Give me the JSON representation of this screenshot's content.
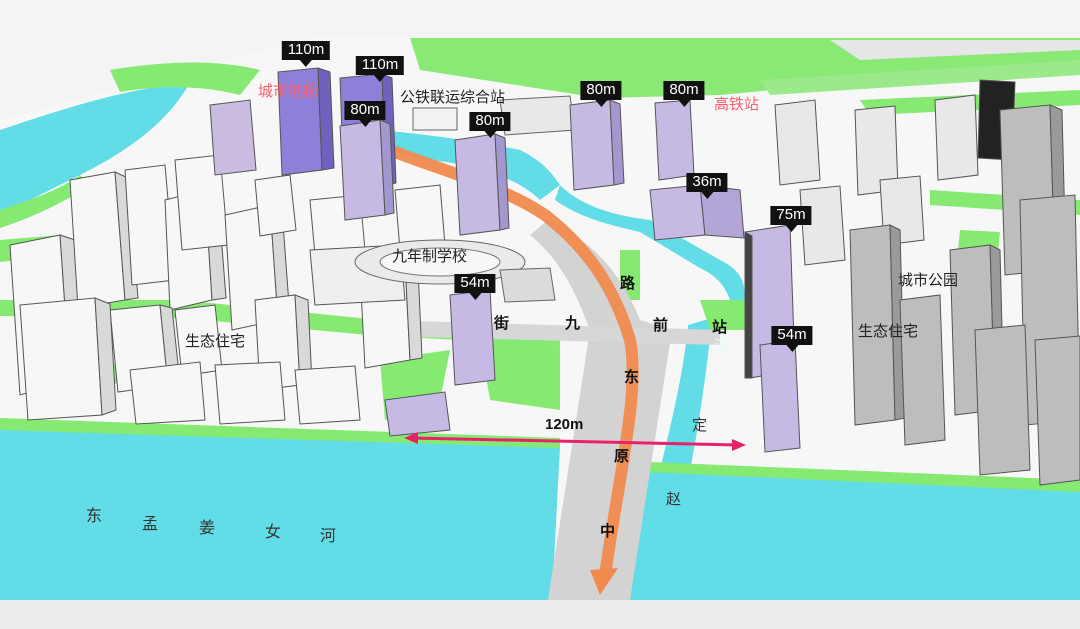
{
  "height_tags": [
    {
      "id": "landmark-1",
      "text": "110m"
    },
    {
      "id": "landmark-2",
      "text": "110m"
    },
    {
      "id": "tower-80-a",
      "text": "80m"
    },
    {
      "id": "tower-80-b",
      "text": "80m"
    },
    {
      "id": "tower-80-c",
      "text": "80m"
    },
    {
      "id": "tower-80-d",
      "text": "80m"
    },
    {
      "id": "tower-36",
      "text": "36m"
    },
    {
      "id": "tower-75",
      "text": "75m"
    },
    {
      "id": "tower-54-a",
      "text": "54m"
    },
    {
      "id": "tower-54-b",
      "text": "54m"
    }
  ],
  "place_labels": {
    "city_landmark": "城市地标",
    "rail_hub": "公铁联运综合站",
    "high_speed_station": "高铁站",
    "school": "九年制学校",
    "city_park": "城市公园",
    "eco_residential_left": "生态住宅",
    "eco_residential_right": "生态住宅"
  },
  "road_labels": {
    "zhongyuan_east_road": [
      "路",
      "东",
      "原",
      "中"
    ],
    "jiuqian_street": [
      "街",
      "九",
      "前",
      "站"
    ],
    "zhaoding_river": [
      "河",
      "定",
      "赵"
    ]
  },
  "river_label": [
    "东",
    "孟",
    "姜",
    "女",
    "河"
  ],
  "dimension": {
    "text": "120m"
  },
  "colors": {
    "water": "#62dce6",
    "green": "#86ea72",
    "ground": "#f6f6f6",
    "road": "#cfcfcf",
    "building": "#f4f4f4",
    "tower": "#c2b6dd",
    "landmark": "#8f7fd8",
    "axis_arrow": "#f08a4e",
    "dimension_line": "#e8226a",
    "label_red": "#ff5f6e"
  }
}
